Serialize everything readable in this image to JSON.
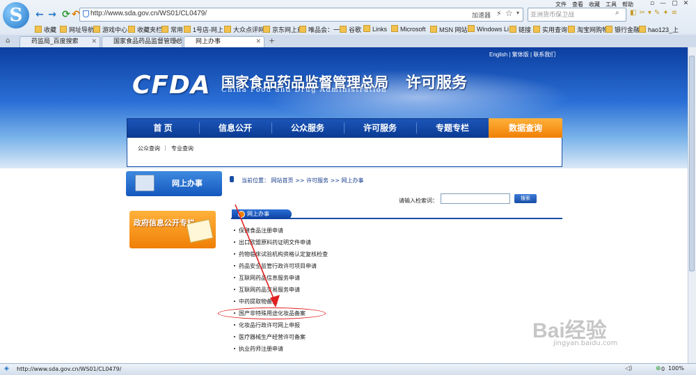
{
  "browser": {
    "address_url": "http://www.sda.gov.cn/WS01/CL0479/",
    "accelerator_label": "加速器",
    "search_placeholder": "亚洲货币保卫战",
    "menu": [
      "文件",
      "查看",
      "收藏",
      "工具",
      "帮助"
    ],
    "favorites": [
      "收藏",
      "网址导航",
      "游戏中心",
      "收藏夹栏",
      "常用",
      "1号店-网上",
      "大众点评网",
      "京东网上商",
      "唯品会：一",
      "谷歌",
      "Links",
      "Microsoft",
      "MSN 网站",
      "Windows Li",
      "链接",
      "实用查询",
      "淘宝网购物",
      "银行金融",
      "hao123_上"
    ],
    "tabs": [
      {
        "label": "药监局_百度搜索",
        "active": false
      },
      {
        "label": "国家食品药品监督管理总",
        "active": false
      },
      {
        "label": "网上办事",
        "active": true
      }
    ],
    "status_url": "http://www.sda.gov.cn/WS01/CL0479/",
    "status_count": "0",
    "zoom": "100%"
  },
  "site": {
    "top_links": "English | 繁体版 | 联系我们",
    "logo_text": "CFDA",
    "name_cn": "国家食品药品监督管理总局",
    "name_en": "China Food and Drug Administration",
    "subtitle": "许可服务"
  },
  "nav": {
    "items": [
      "首 页",
      "信息公开",
      "公众服务",
      "许可服务",
      "专题专栏",
      "数据查询"
    ],
    "sub_items": [
      "公众查询",
      "专业查询"
    ]
  },
  "sidebar": {
    "online_service": "网上办事",
    "gov_info": "政府信息公开专栏"
  },
  "main": {
    "breadcrumb_label": "当前位置：",
    "breadcrumb": [
      "网站首页",
      "许可服务",
      "网上办事"
    ],
    "search_label": "请输入检索词：",
    "search_button": "搜索",
    "section_title": "网上办事",
    "items": [
      "保健食品注册申请",
      "出口欧盟原料药证明文件申请",
      "药物临床试验机构资格认定复核检查",
      "药品安全监管行政许可项目申请",
      "互联网药品信息服务申请",
      "互联网药品交易服务申请",
      "中药提取物备案",
      "国产非特殊用途化妆品备案",
      "化妆品行政许可网上申报",
      "医疗器械生产经营许可备案",
      "执业药师注册申请"
    ],
    "highlighted_item": "国产非特殊用途化妆品备案"
  },
  "watermark": {
    "logo": "Bai经验",
    "url": "jingyan.baidu.com"
  },
  "colors": {
    "nav_blue": "#0b3c94",
    "accent_orange": "#f07f06",
    "annotation_red": "#e02020"
  }
}
